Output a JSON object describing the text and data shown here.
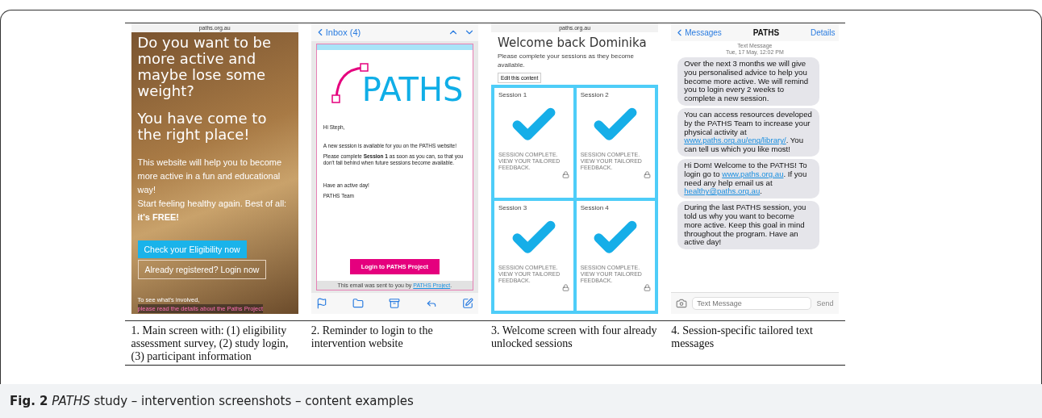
{
  "screen_1": {
    "url": "paths.org.au",
    "heading_1": "Do you want to be more active and maybe lose some weight?",
    "heading_2": "You have come to the right place!",
    "body": "This website will help you to become more active in a fun and educational way!\nStart feeling healthy again. Best of all: **it's FREE!**",
    "primary_button": "Check your Eligibility now",
    "secondary_button": "Already registered? Login now",
    "footer_text": "To see what's involved, ",
    "footer_link": "please read the details about the Paths Project"
  },
  "screen_2": {
    "back": "Inbox (4)",
    "logo_text": "PATHS",
    "greeting": "Hi Steph,",
    "paragraphs": [
      "A new session is available for you on the PATHS website!",
      "Please complete **Session 1**  as soon as you can, so that you don't fall behind when future sessions become available."
    ],
    "signoff": [
      "Have an active day!",
      "PATHS Team"
    ],
    "button": "Login to PATHS Project",
    "footer_before": "This email was sent to you by ",
    "footer_link": "PATHS Project",
    "footer_after": "."
  },
  "screen_3": {
    "url": "paths.org.au",
    "title": "Welcome back Dominika",
    "subtitle": "Please complete your sessions as they become available.",
    "edit_button": "Edit this content",
    "sessions": [
      {
        "label": "Session 1",
        "status": "SESSION COMPLETE. VIEW YOUR TAILORED FEEDBACK.",
        "complete": true
      },
      {
        "label": "Session 2",
        "status": "SESSION COMPLETE. VIEW YOUR TAILORED FEEDBACK.",
        "complete": true
      },
      {
        "label": "Session 3",
        "status": "SESSION COMPLETE. VIEW YOUR TAILORED FEEDBACK.",
        "complete": true
      },
      {
        "label": "Session 4",
        "status": "SESSION COMPLETE. VIEW YOUR TAILORED FEEDBACK.",
        "complete": true
      }
    ]
  },
  "screen_4": {
    "back": "Messages",
    "title": "PATHS",
    "details": "Details",
    "meta_1": "Text Message",
    "meta_2": "Tue, 17 May, 12:02 PM",
    "messages": [
      [
        {
          "text": "Over the next 3 months we will give you personalised advice to help you become more active. We will remind you to login every 2 weeks to complete a new session.",
          "kind": "text"
        }
      ],
      [
        {
          "text": "You can access resources developed by the PATHS Team to increase your physical activity at ",
          "kind": "text"
        },
        {
          "text": "www.paths.org.au/eng/library/",
          "kind": "link"
        },
        {
          "text": ". You can tell us which you like most!",
          "kind": "text"
        }
      ],
      [
        {
          "text": "Hi Dom! Welcome to the PATHS! To login go to ",
          "kind": "text"
        },
        {
          "text": "www.paths.org.au",
          "kind": "link"
        },
        {
          "text": ". If you need any help email us at ",
          "kind": "text"
        },
        {
          "text": "healthy@paths.org.au",
          "kind": "link"
        },
        {
          "text": ".",
          "kind": "text"
        }
      ],
      [
        {
          "text": "During the last PATHS session, you told us why you want to become more active. Keep this goal in mind throughout the program. Have an active day!",
          "kind": "text"
        }
      ]
    ],
    "input_placeholder": "Text Message",
    "send": "Send"
  },
  "captions": [
    "1. Main screen with: (1) eligibility assessment survey, (2) study login, (3) participant information",
    "2. Reminder to login to the intervention website",
    "3. Welcome screen with four already  unlocked sessions",
    "4. Session-specific tailored text messages"
  ],
  "figure_caption": "**Fig. 2** *PATHS* study – intervention screenshots – content examples"
}
